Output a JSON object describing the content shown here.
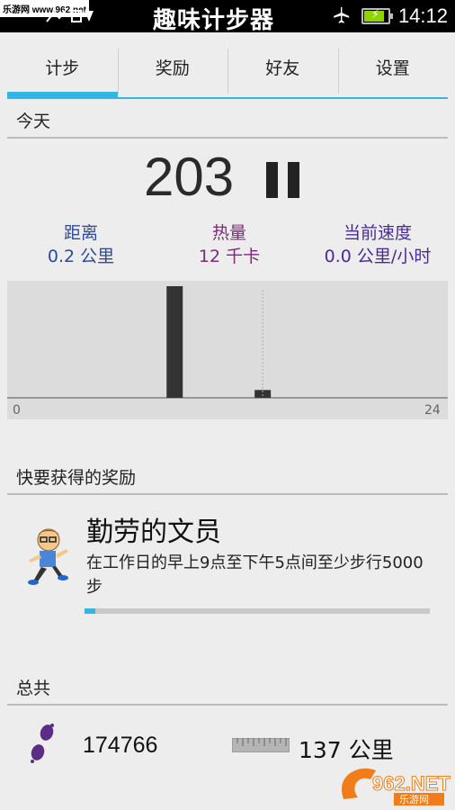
{
  "status_bar": {
    "watermark": "乐游网 www.962.net",
    "app_title": "趣味计步器",
    "time": "14:12"
  },
  "tabs": [
    {
      "label": "计步",
      "active": true
    },
    {
      "label": "奖励",
      "active": false
    },
    {
      "label": "好友",
      "active": false
    },
    {
      "label": "设置",
      "active": false
    }
  ],
  "today": {
    "header": "今天",
    "steps": "203",
    "stats": {
      "distance_label": "距离",
      "distance_value": "0.2 公里",
      "calories_label": "热量",
      "calories_value": "12 千卡",
      "speed_label": "当前速度",
      "speed_value": "0.0 公里/小时"
    }
  },
  "chart_data": {
    "type": "bar",
    "x_min_label": "0",
    "x_max_label": "24",
    "xlim": [
      0,
      24
    ],
    "bars": [
      {
        "hour": 9,
        "value": 1.0
      },
      {
        "hour": 14,
        "value": 0.07
      }
    ],
    "current_hour_marker": 14
  },
  "rewards": {
    "header": "快要获得的奖励",
    "title": "勤劳的文员",
    "description": "在工作日的早上9点至下午5点间至少步行5000步",
    "progress": 0.03
  },
  "total": {
    "header": "总共",
    "steps": "174766",
    "distance": "137 公里"
  },
  "watermark_br": {
    "brand": "962.NET",
    "sub": "乐游网"
  },
  "colors": {
    "accent": "#33b5e5",
    "distance": "#2c4a9c",
    "calories": "#7b2a7b",
    "speed": "#4a2a9a"
  }
}
